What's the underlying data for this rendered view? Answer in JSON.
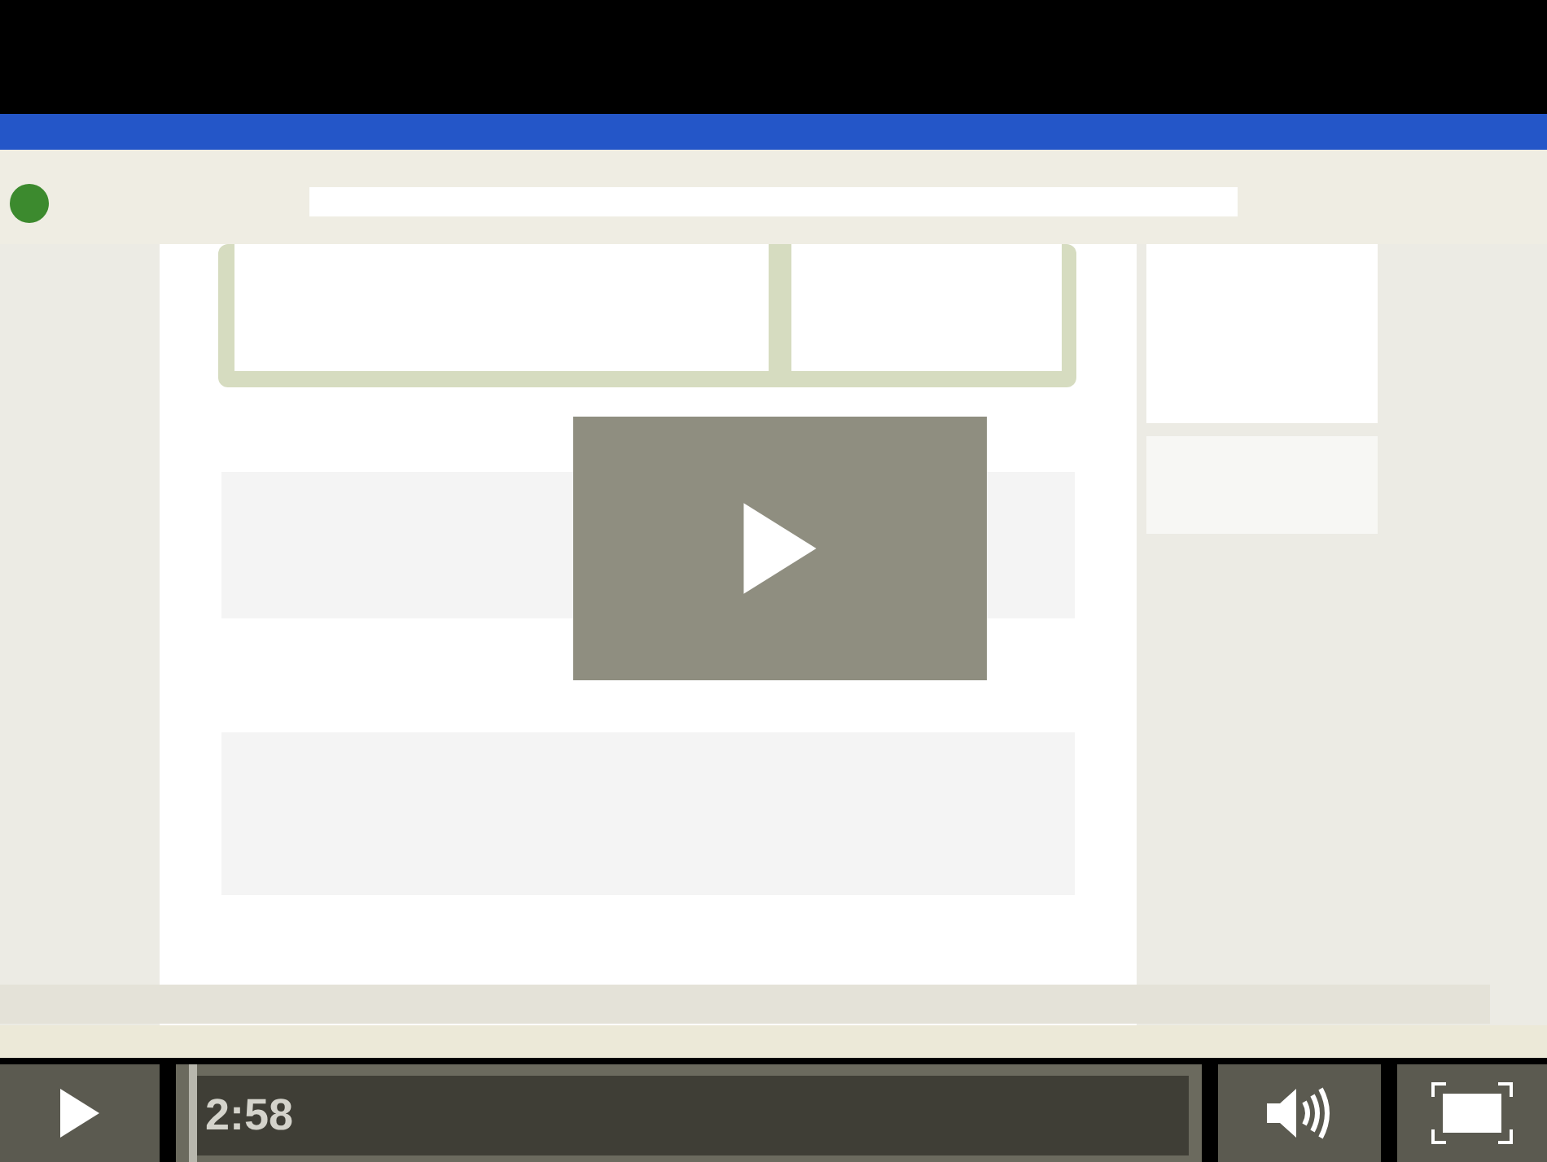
{
  "controls": {
    "playing": false,
    "time": "2:58",
    "progress": {
      "level": 0
    }
  }
}
